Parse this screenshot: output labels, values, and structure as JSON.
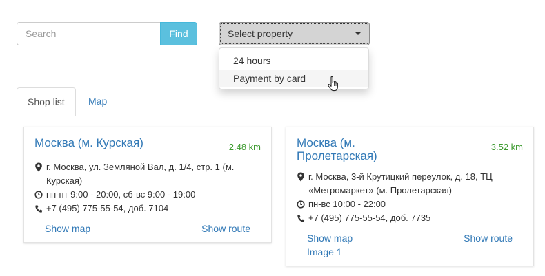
{
  "search": {
    "placeholder": "Search",
    "value": "",
    "button_label": "Find"
  },
  "property_select": {
    "label": "Select property",
    "options": [
      "24 hours",
      "Payment by card"
    ],
    "hovered_option": "Payment by card"
  },
  "tabs": [
    {
      "label": "Shop list",
      "active": true
    },
    {
      "label": "Map",
      "active": false
    }
  ],
  "shops": [
    {
      "title": "Москва (м. Курская)",
      "distance": "2.48 km",
      "address": "г. Москва, ул. Земляной Вал, д. 1/4, стр. 1 (м. Курская)",
      "hours": "пн-пт 9:00 - 20:00, сб-вс 9:00 - 19:00",
      "phone": "+7 (495) 775-55-54, доб. 7104",
      "show_map": "Show map",
      "show_route": "Show route"
    },
    {
      "title": "Москва (м. Пролетарская)",
      "distance": "3.52 km",
      "address": "г. Москва, 3-й Крутицкий переулок, д. 18, ТЦ «Метромаркет» (м. Пролетарская)",
      "hours": "пн-вс 10:00 - 22:00",
      "phone": "+7 (495) 775-55-54, доб. 7735",
      "show_map": "Show map",
      "show_route": "Show route",
      "image_link": "Image 1"
    }
  ],
  "colors": {
    "link": "#337ab7",
    "find_button": "#5bc0de",
    "distance": "#3c9a2e",
    "select_button": "#d4d4d4"
  },
  "icons": [
    "map-marker-icon",
    "clock-icon",
    "phone-icon",
    "caret-down-icon",
    "hand-cursor-icon"
  ]
}
